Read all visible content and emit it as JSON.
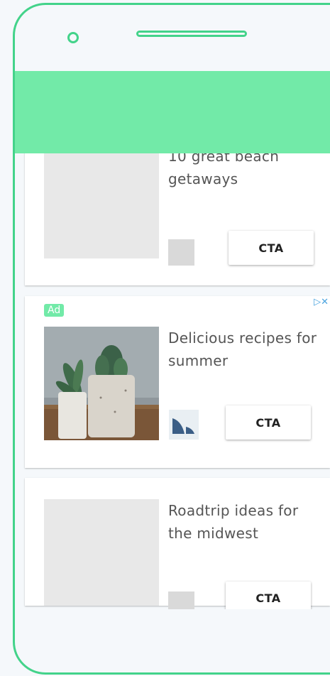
{
  "app_bar": {
    "color": "#72eaa8"
  },
  "feed": [
    {
      "title": "10 great beach getaways",
      "cta": "CTA"
    },
    {
      "ad_badge": "Ad",
      "adchoices_icon": "adchoices-icon",
      "title": "Delicious recipes for summer",
      "cta": "CTA"
    },
    {
      "title": "Roadtrip ideas for the midwest",
      "cta": "CTA"
    }
  ]
}
